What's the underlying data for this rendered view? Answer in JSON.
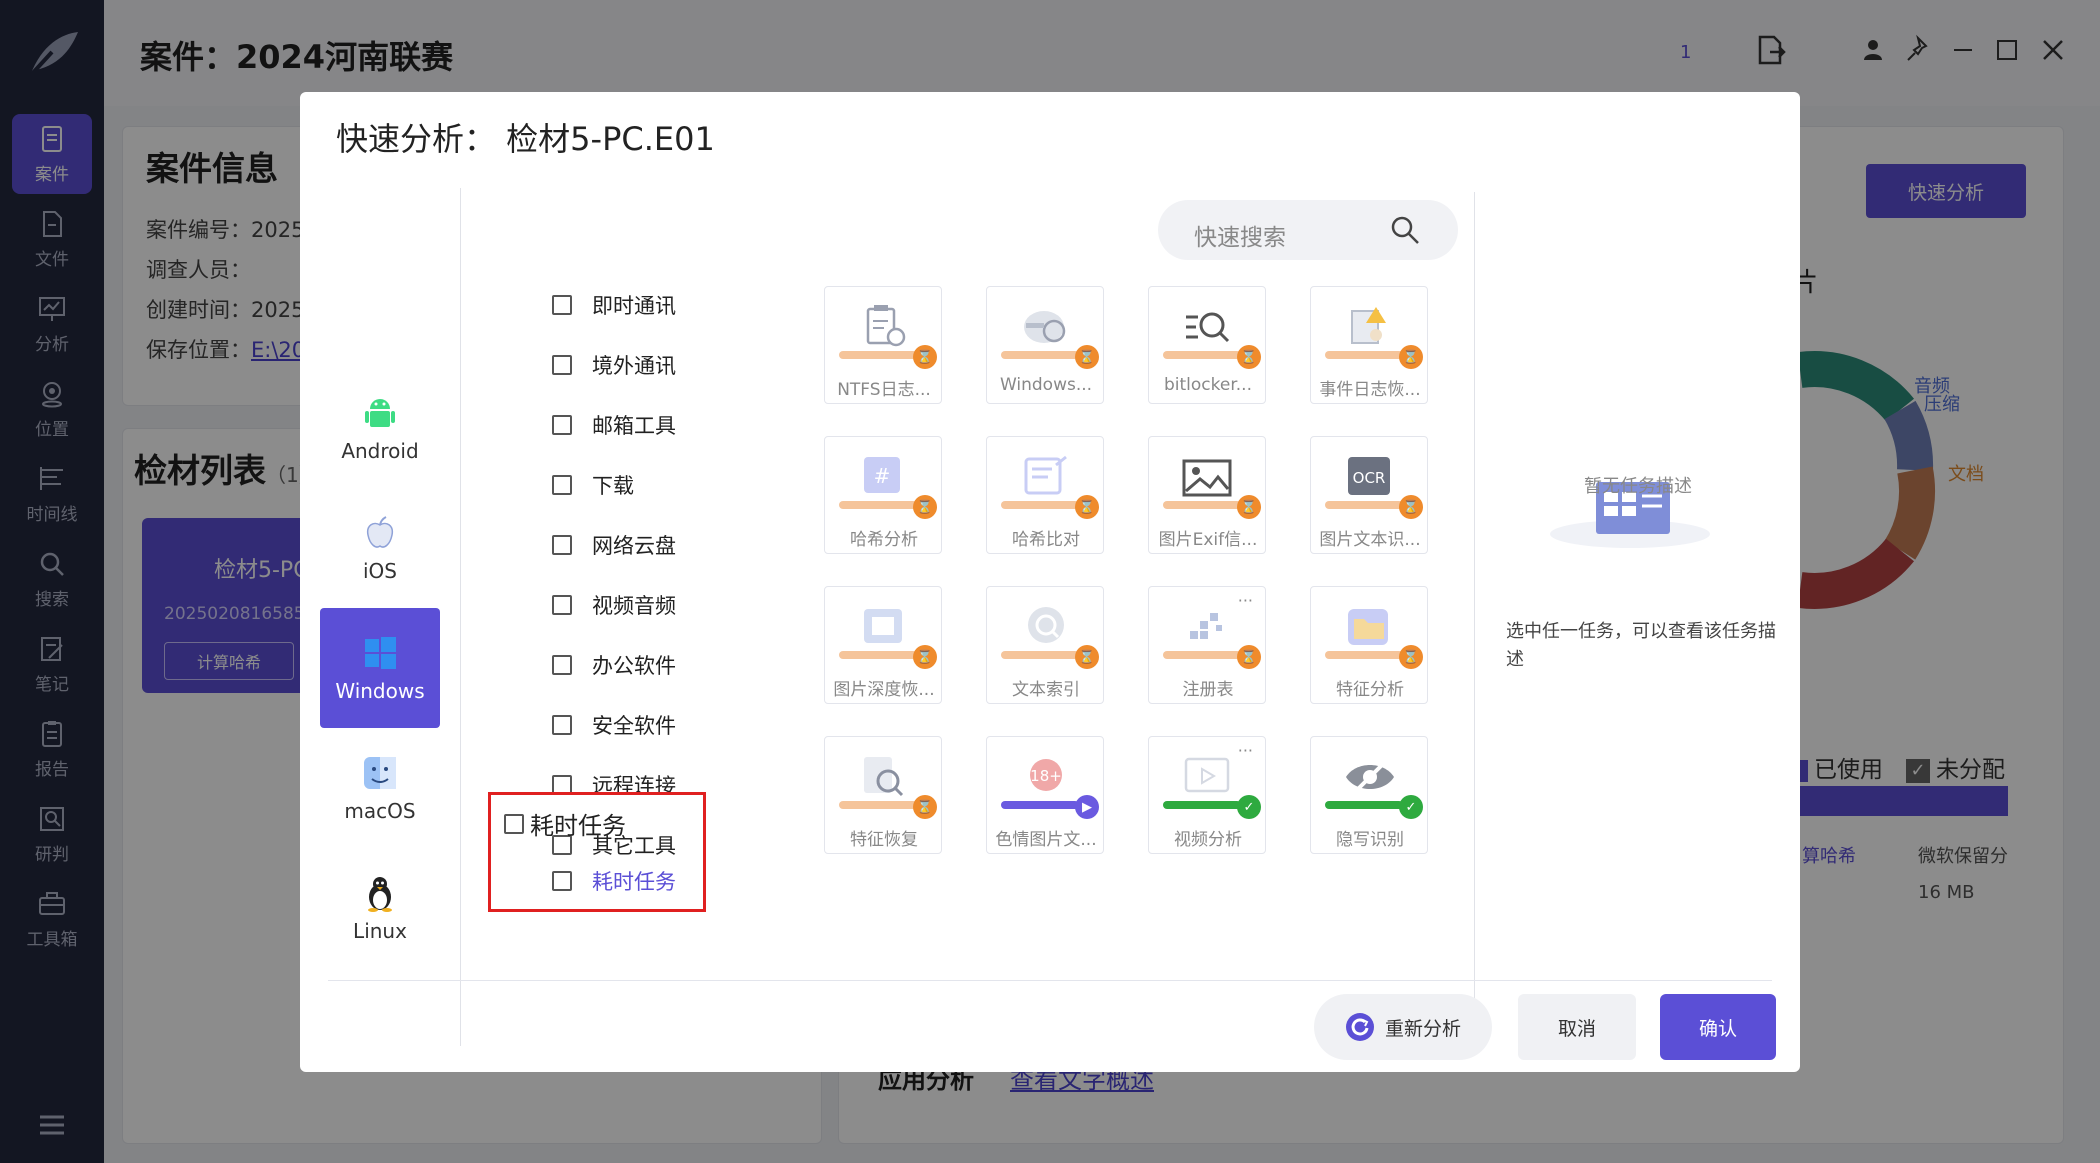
{
  "app": {
    "title": "案件：2024河南联赛",
    "top_count": "1"
  },
  "nav": [
    {
      "label": "案件",
      "icon": "case-icon"
    },
    {
      "label": "文件",
      "icon": "file-icon"
    },
    {
      "label": "分析",
      "icon": "analysis-icon"
    },
    {
      "label": "位置",
      "icon": "location-icon"
    },
    {
      "label": "时间线",
      "icon": "timeline-icon"
    },
    {
      "label": "搜索",
      "icon": "search-icon"
    },
    {
      "label": "笔记",
      "icon": "note-icon"
    },
    {
      "label": "报告",
      "icon": "report-icon"
    },
    {
      "label": "研判",
      "icon": "judge-icon"
    },
    {
      "label": "工具箱",
      "icon": "toolbox-icon"
    }
  ],
  "case_info": {
    "title": "案件信息",
    "rows": [
      {
        "label": "案件编号：",
        "value": "2025"
      },
      {
        "label": "调查人员：",
        "value": ""
      },
      {
        "label": "创建时间：",
        "value": "2025"
      },
      {
        "label": "保存位置：",
        "value": "E:\\20"
      }
    ]
  },
  "evidence_list": {
    "title": "检材列表",
    "count": "（1）",
    "card_name": "检材5-PC",
    "card_date": "2025020816585",
    "card_button": "计算哈希"
  },
  "right_panel": {
    "quick_btn": "快速分析",
    "title_partial": "片",
    "legend": [
      "音频",
      "压缩",
      "文档"
    ],
    "used": "已使用",
    "unassigned": "未分配",
    "col1": "算哈希",
    "col2": "微软保留分",
    "size": "16 MB",
    "bottom_title": "应用分析",
    "bottom_link": "查看文字概述"
  },
  "modal": {
    "title": "快速分析：  检材5-PC.E01",
    "os_items": [
      {
        "label": "Android",
        "icon": "android-icon",
        "active": false
      },
      {
        "label": "iOS",
        "icon": "apple-icon",
        "active": false
      },
      {
        "label": "Windows",
        "icon": "windows-icon",
        "active": true
      },
      {
        "label": "macOS",
        "icon": "finder-icon",
        "active": false
      },
      {
        "label": "Linux",
        "icon": "penguin-icon",
        "active": false
      }
    ],
    "categories": [
      "即时通讯",
      "境外通讯",
      "邮箱工具",
      "下载",
      "网络云盘",
      "视频音频",
      "办公软件",
      "安全软件",
      "远程连接",
      "其它工具"
    ],
    "time_group": "耗时任务",
    "time_item": "耗时任务",
    "search_placeholder": "快速搜索",
    "tiles": [
      {
        "label": "NTFS日志...",
        "icon": "clipboard-clock-icon",
        "status": "pending"
      },
      {
        "label": "Windows...",
        "icon": "disk-search-icon",
        "status": "pending"
      },
      {
        "label": "bitlocker...",
        "icon": "magnifier-list-icon",
        "status": "pending"
      },
      {
        "label": "事件日志恢...",
        "icon": "event-log-icon",
        "status": "pending"
      },
      {
        "label": "哈希分析",
        "icon": "hash-frame-icon",
        "status": "pending"
      },
      {
        "label": "哈希比对",
        "icon": "hash-doc-icon",
        "status": "pending"
      },
      {
        "label": "图片Exif信...",
        "icon": "picture-icon",
        "status": "pending"
      },
      {
        "label": "图片文本识...",
        "icon": "ocr-icon",
        "status": "pending"
      },
      {
        "label": "图片深度恢...",
        "icon": "image-stack-icon",
        "status": "pending"
      },
      {
        "label": "文本索引",
        "icon": "text-index-icon",
        "status": "pending"
      },
      {
        "label": "注册表",
        "icon": "registry-icon",
        "status": "pending"
      },
      {
        "label": "特征分析",
        "icon": "folder-shield-icon",
        "status": "pending"
      },
      {
        "label": "特征恢复",
        "icon": "doc-search-icon",
        "status": "pending"
      },
      {
        "label": "色情图片文...",
        "icon": "adult-18-icon",
        "status": "running"
      },
      {
        "label": "视频分析",
        "icon": "video-window-icon",
        "status": "done"
      },
      {
        "label": "隐写识别",
        "icon": "eye-hidden-icon",
        "status": "done"
      }
    ],
    "desc_empty": "暂无任务描述",
    "desc_tip": "选中任一任务，可以查看该任务描述",
    "btn_reanalyze": "重新分析",
    "btn_cancel": "取消",
    "btn_confirm": "确认"
  },
  "colors": {
    "accent": "#5b4fd6",
    "nav_bg": "#24283f",
    "pending": "#ef8b2c",
    "done": "#2eaa3f",
    "highlight": "#e02020"
  }
}
